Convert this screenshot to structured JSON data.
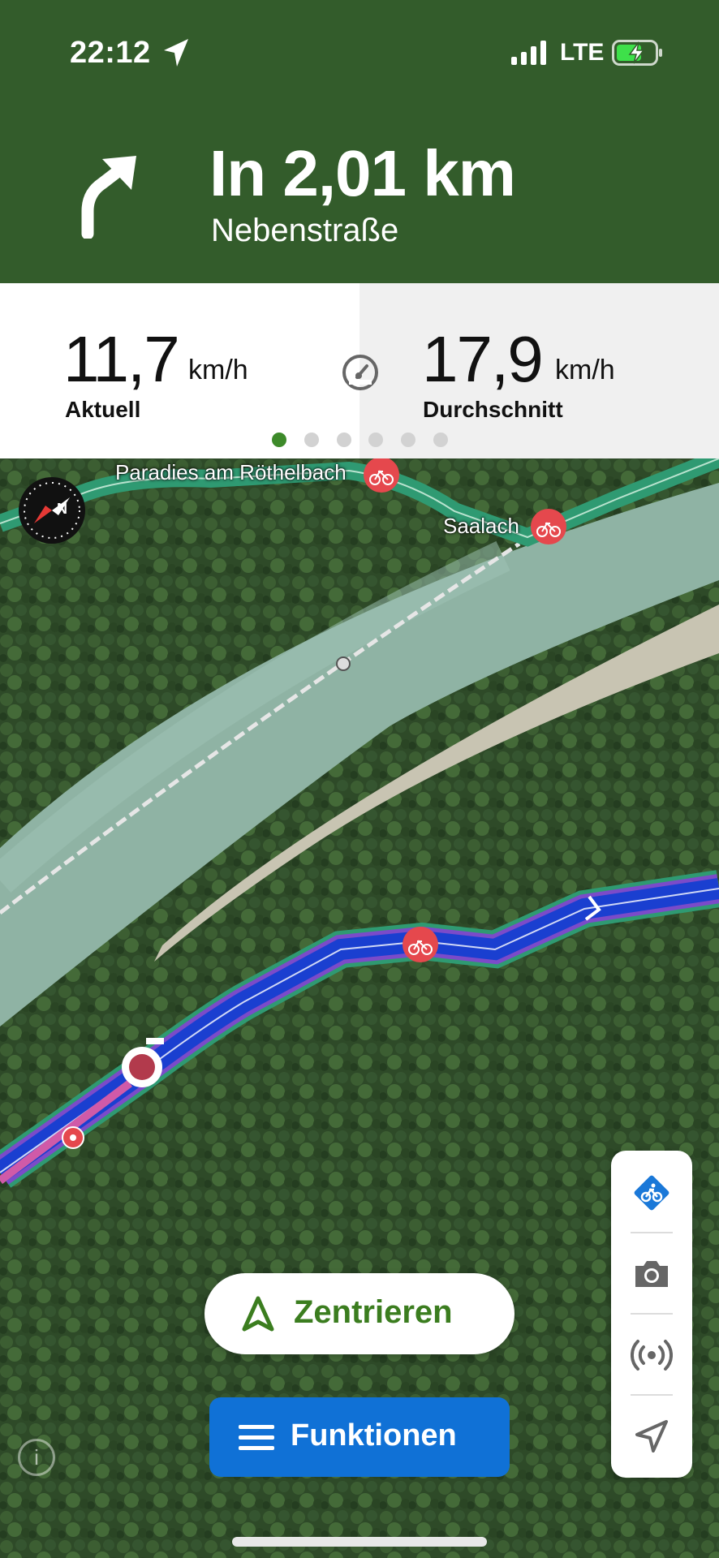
{
  "status_bar": {
    "time": "22:12",
    "network": "LTE",
    "icons": [
      "location-arrow-icon",
      "signal-icon",
      "battery-charging-icon"
    ]
  },
  "navigation": {
    "maneuver_icon": "turn-slight-right-icon",
    "distance": "In 2,01 km",
    "street": "Nebenstraße",
    "header_color": "#335c2b"
  },
  "stats": {
    "current": {
      "value": "11,7",
      "unit": "km/h",
      "label": "Aktuell"
    },
    "average": {
      "value": "17,9",
      "unit": "km/h",
      "label": "Durchschnitt"
    },
    "middle_icon": "speedometer-icon",
    "page_count": 6,
    "active_page": 1
  },
  "map": {
    "labels": {
      "poi_1": "Paradies am Röthelbach",
      "poi_2": "Saalach"
    },
    "route_color": "#1a3fd0",
    "bike_route_color": "#2f9a72",
    "bike_marker_color": "#e5484d"
  },
  "controls": {
    "center_label": "Zentrieren",
    "functions_label": "Funktionen",
    "sidebar": [
      "bike-mode-icon",
      "camera-icon",
      "broadcast-icon",
      "navigation-arrow-icon"
    ],
    "accent_green": "#3b7d1f",
    "accent_blue": "#1071d6"
  }
}
